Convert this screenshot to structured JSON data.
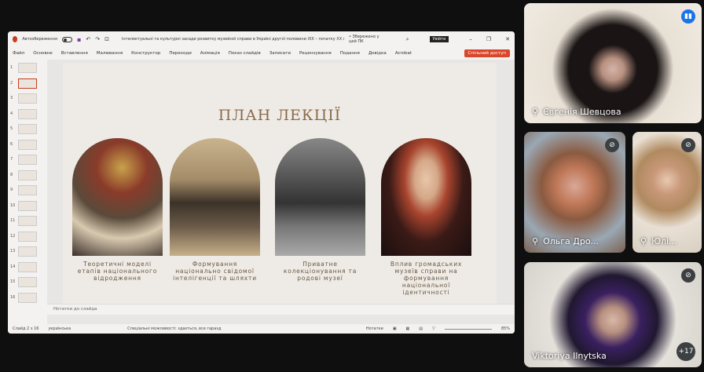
{
  "ppt": {
    "autosave_label": "Автозбереження",
    "doc_title": "Інтелектуальні та культурні засади розвитку музейної справи в Україні другої половини XIX – початку XX ст. як форма збереження і...",
    "saved_label": "• Збережено у цей ПК",
    "signin": "Увійти",
    "menu": [
      "Файл",
      "Основне",
      "Вставлення",
      "Малювання",
      "Конструктор",
      "Переходи",
      "Анімація",
      "Показ слайдів",
      "Записати",
      "Рецензування",
      "Подання",
      "Довідка",
      "Acrobat"
    ],
    "share_label": "Спільний доступ",
    "thumb_numbers": [
      "1",
      "2",
      "3",
      "4",
      "5",
      "6",
      "7",
      "8",
      "9",
      "10",
      "11",
      "12",
      "13",
      "14",
      "15",
      "16"
    ],
    "slide": {
      "title": "ПЛАН ЛЕКЦІЇ",
      "cards": [
        {
          "caption": "Теоретичні моделі етапів національного відродження"
        },
        {
          "caption": "Формування національно свідомої інтелігенції та шляхти"
        },
        {
          "caption": "Приватне колекціонування та родові музеї"
        },
        {
          "caption": "Вплив громадських музеїв справи на формування національної ідентичності"
        }
      ]
    },
    "notes_placeholder": "Нотатки до слайда",
    "status": {
      "slide": "Слайд 2 з 16",
      "language": "українська",
      "accessibility": "Спеціальні можливості: здається, все гаразд",
      "notes": "Нотатки",
      "zoom": "85%"
    }
  },
  "participants": [
    {
      "name": "Євгенія Шевцова"
    },
    {
      "name": "Ольга Дро..."
    },
    {
      "name": "Юлі..."
    },
    {
      "name": "Viktoriya Ilnytska"
    }
  ],
  "more_count": "+17"
}
